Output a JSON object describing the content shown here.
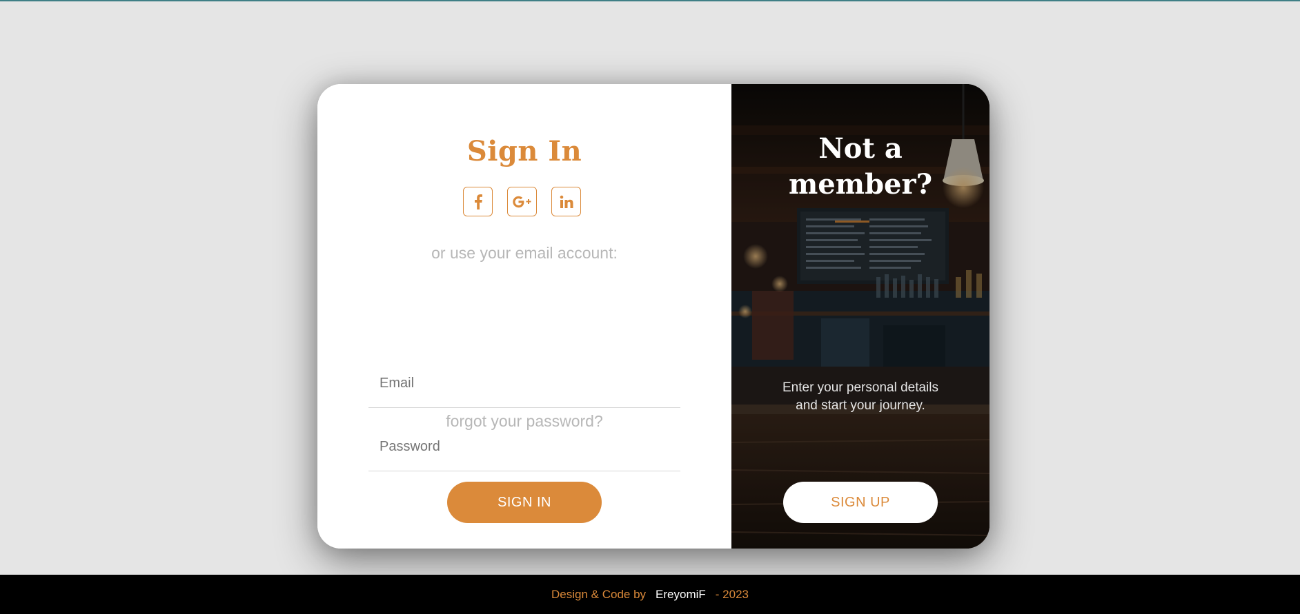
{
  "signin": {
    "title": "Sign In",
    "social": [
      {
        "icon": "facebook-icon",
        "label": "f"
      },
      {
        "icon": "google-plus-icon",
        "label": "G+"
      },
      {
        "icon": "linkedin-icon",
        "label": "in"
      }
    ],
    "hint": "or use your email account:",
    "email_placeholder": "Email",
    "password_placeholder": "Password",
    "forgot": "forgot your password?",
    "button": "SIGN IN"
  },
  "signup": {
    "title_line1": "Not a",
    "title_line2": "member?",
    "text_line1": "Enter your personal details",
    "text_line2": "and start your journey.",
    "button": "SIGN UP"
  },
  "footer": {
    "prefix": "Design & Code by",
    "author": "EreyomiF",
    "suffix": "- 2023"
  },
  "colors": {
    "accent": "#db8a3a",
    "footer_bg": "#000000",
    "page_bg": "#e5e5e5"
  }
}
